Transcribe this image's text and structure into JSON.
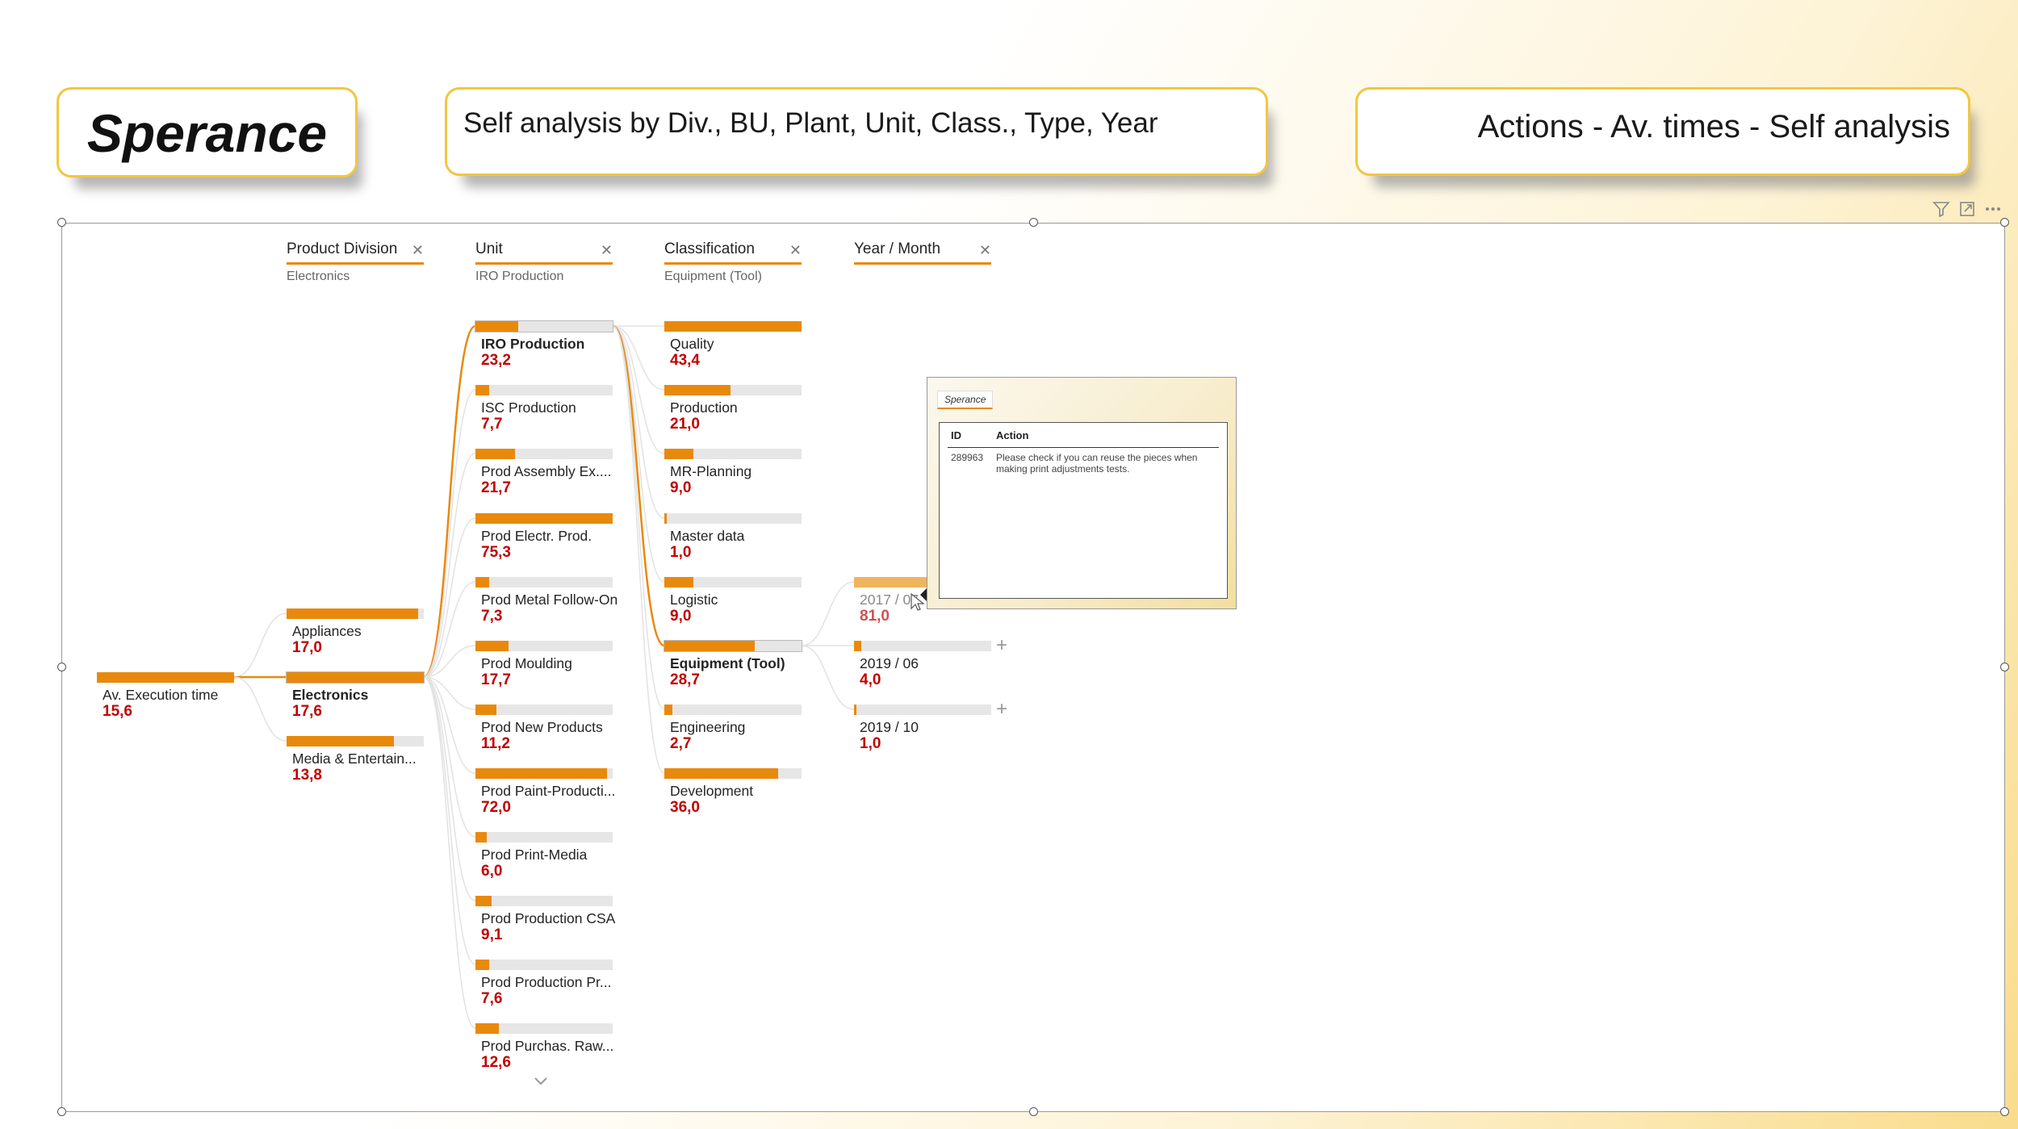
{
  "header": {
    "logo": "Sperance",
    "subtitle": "Self analysis by Div., BU, Plant, Unit, Class., Type, Year",
    "section_title": "Actions - Av. times - Self analysis"
  },
  "colors": {
    "accent": "#e8890c",
    "value": "#c00000",
    "header_border": "#f2c641"
  },
  "visual_toolbar": {
    "icons": [
      "filter-icon",
      "focus-mode-icon",
      "more-options-icon"
    ]
  },
  "levels": [
    {
      "title": "Product Division",
      "filter": "Electronics"
    },
    {
      "title": "Unit",
      "filter": "IRO Production"
    },
    {
      "title": "Classification",
      "filter": "Equipment (Tool)"
    },
    {
      "title": "Year / Month",
      "filter": ""
    }
  ],
  "root": {
    "label": "Av. Execution time",
    "value": "15,6",
    "fill": 1.0
  },
  "divisions": [
    {
      "label": "Appliances",
      "value": "17,0",
      "fill": 0.96
    },
    {
      "label": "Electronics",
      "value": "17,6",
      "fill": 1.0,
      "selected": true
    },
    {
      "label": "Media & Entertain...",
      "value": "13,8",
      "fill": 0.78
    }
  ],
  "units": [
    {
      "label": "IRO Production",
      "value": "23,2",
      "fill": 0.31,
      "selected": true
    },
    {
      "label": "ISC Production",
      "value": "7,7",
      "fill": 0.1
    },
    {
      "label": "Prod Assembly Ex....",
      "value": "21,7",
      "fill": 0.29
    },
    {
      "label": "Prod Electr. Prod.",
      "value": "75,3",
      "fill": 1.0
    },
    {
      "label": "Prod Metal Follow-On",
      "value": "7,3",
      "fill": 0.1
    },
    {
      "label": "Prod Moulding",
      "value": "17,7",
      "fill": 0.24
    },
    {
      "label": "Prod New Products",
      "value": "11,2",
      "fill": 0.15
    },
    {
      "label": "Prod Paint-Producti...",
      "value": "72,0",
      "fill": 0.96
    },
    {
      "label": "Prod Print-Media",
      "value": "6,0",
      "fill": 0.08
    },
    {
      "label": "Prod Production CSA",
      "value": "9,1",
      "fill": 0.12
    },
    {
      "label": "Prod Production Pr...",
      "value": "7,6",
      "fill": 0.1
    },
    {
      "label": "Prod Purchas. Raw...",
      "value": "12,6",
      "fill": 0.17
    }
  ],
  "classifications": [
    {
      "label": "Quality",
      "value": "43,4",
      "fill": 1.0
    },
    {
      "label": "Production",
      "value": "21,0",
      "fill": 0.48
    },
    {
      "label": "MR-Planning",
      "value": "9,0",
      "fill": 0.21
    },
    {
      "label": "Master data",
      "value": "1,0",
      "fill": 0.02
    },
    {
      "label": "Logistic",
      "value": "9,0",
      "fill": 0.21
    },
    {
      "label": "Equipment (Tool)",
      "value": "28,7",
      "fill": 0.66,
      "selected": true
    },
    {
      "label": "Engineering",
      "value": "2,7",
      "fill": 0.06
    },
    {
      "label": "Development",
      "value": "36,0",
      "fill": 0.83
    }
  ],
  "periods": [
    {
      "label": "2017 / 07",
      "value": "81,0",
      "fill": 1.0,
      "hovered": true
    },
    {
      "label": "2019 / 06",
      "value": "4,0",
      "fill": 0.05
    },
    {
      "label": "2019 / 10",
      "value": "1,0",
      "fill": 0.01
    }
  ],
  "expand_symbol": "+",
  "tooltip": {
    "tab": "Sperance",
    "columns": [
      "ID",
      "Action"
    ],
    "rows": [
      {
        "id": "289963",
        "action": "Please check if you can reuse the pieces when making print adjustments tests."
      }
    ]
  }
}
